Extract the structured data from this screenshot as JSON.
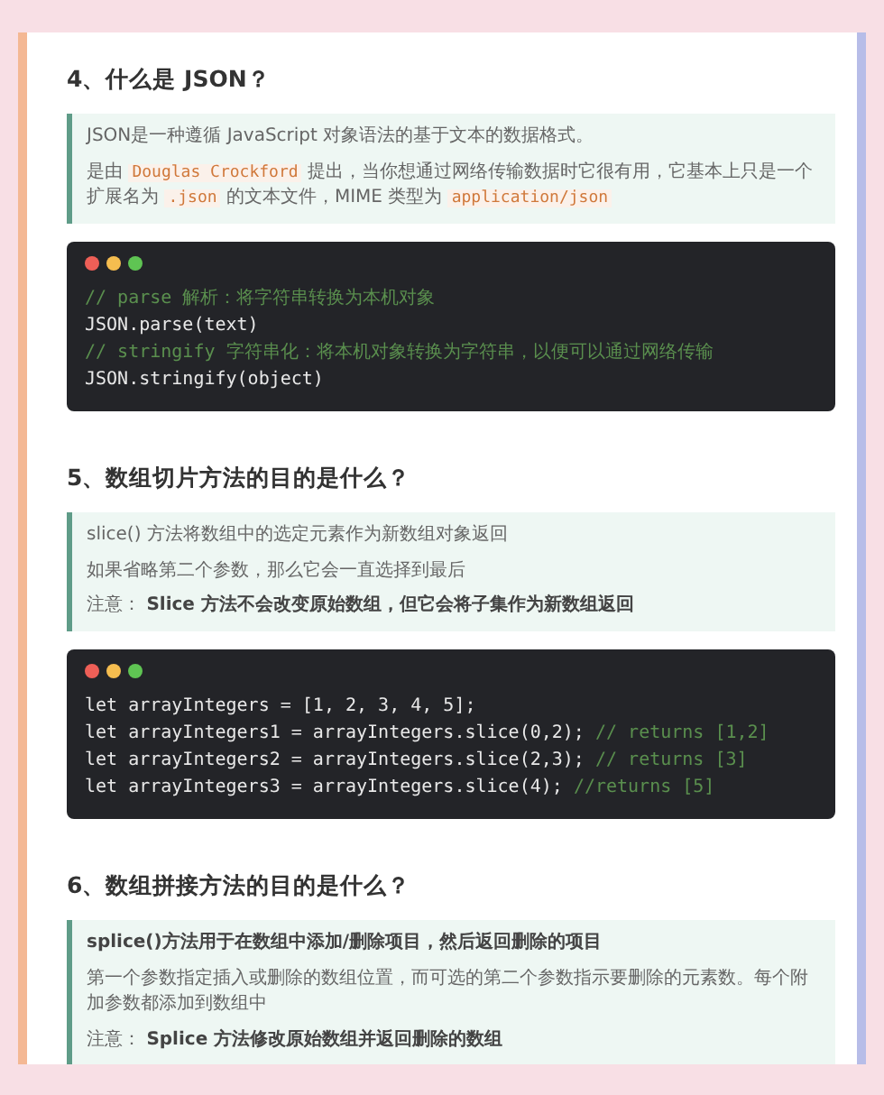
{
  "sections": [
    {
      "heading": "4、什么是 JSON？",
      "notes": [
        {
          "kind": "text",
          "parts": [
            {
              "kind": "text",
              "text": "JSON是一种遵循 JavaScript 对象语法的基于文本的数据格式。"
            }
          ]
        },
        {
          "kind": "text",
          "parts": [
            {
              "kind": "text",
              "text": "是由 "
            },
            {
              "kind": "code",
              "text": "Douglas Crockford"
            },
            {
              "kind": "text",
              "text": " 提出，当你想通过网络传输数据时它很有用，它基本上只是一个扩展名为 "
            },
            {
              "kind": "code",
              "text": ".json"
            },
            {
              "kind": "text",
              "text": " 的文本文件，MIME 类型为 "
            },
            {
              "kind": "code",
              "text": "application/json"
            }
          ]
        }
      ],
      "code": [
        {
          "comment": "// parse 解析：将字符串转换为本机对象"
        },
        {
          "code": "JSON.parse(text)"
        },
        {
          "comment": "// stringify 字符串化：将本机对象转换为字符串，以便可以通过网络传输"
        },
        {
          "code": "JSON.stringify(object)"
        }
      ]
    },
    {
      "heading": "5、数组切片方法的目的是什么？",
      "notes": [
        {
          "kind": "text",
          "parts": [
            {
              "kind": "text",
              "text": "slice() 方法将数组中的选定元素作为新数组对象返回"
            }
          ]
        },
        {
          "kind": "text",
          "parts": [
            {
              "kind": "text",
              "text": "如果省略第二个参数，那么它会一直选择到最后"
            }
          ]
        },
        {
          "kind": "note",
          "parts": [
            {
              "kind": "text",
              "text": "注意： **Slice 方法不会改变原始数组，但它会将子集作为新数组返回**"
            }
          ]
        }
      ],
      "code": [
        {
          "code": "let arrayIntegers = [1, 2, 3, 4, 5];"
        },
        {
          "code": "let arrayIntegers1 = arrayIntegers.slice(0,2);",
          "comment": "// returns [1,2]"
        },
        {
          "code": "let arrayIntegers2 = arrayIntegers.slice(2,3);",
          "comment": "// returns [3]"
        },
        {
          "code": "let arrayIntegers3 = arrayIntegers.slice(4);",
          "comment": "//returns [5]"
        }
      ]
    },
    {
      "heading": "6、数组拼接方法的目的是什么？",
      "notes": [
        {
          "kind": "lead",
          "parts": [
            {
              "kind": "text",
              "text": "splice()方法用于在数组中添加/删除项目，然后返回删除的项目"
            }
          ]
        },
        {
          "kind": "text",
          "parts": [
            {
              "kind": "text",
              "text": "第一个参数指定插入或删除的数组位置，而可选的第二个参数指示要删除的元素数。每个附加参数都添加到数组中"
            }
          ]
        },
        {
          "kind": "note",
          "parts": [
            {
              "kind": "text",
              "text": "注意： **Splice 方法修改原始数组并返回删除的数组**"
            }
          ]
        }
      ]
    }
  ]
}
